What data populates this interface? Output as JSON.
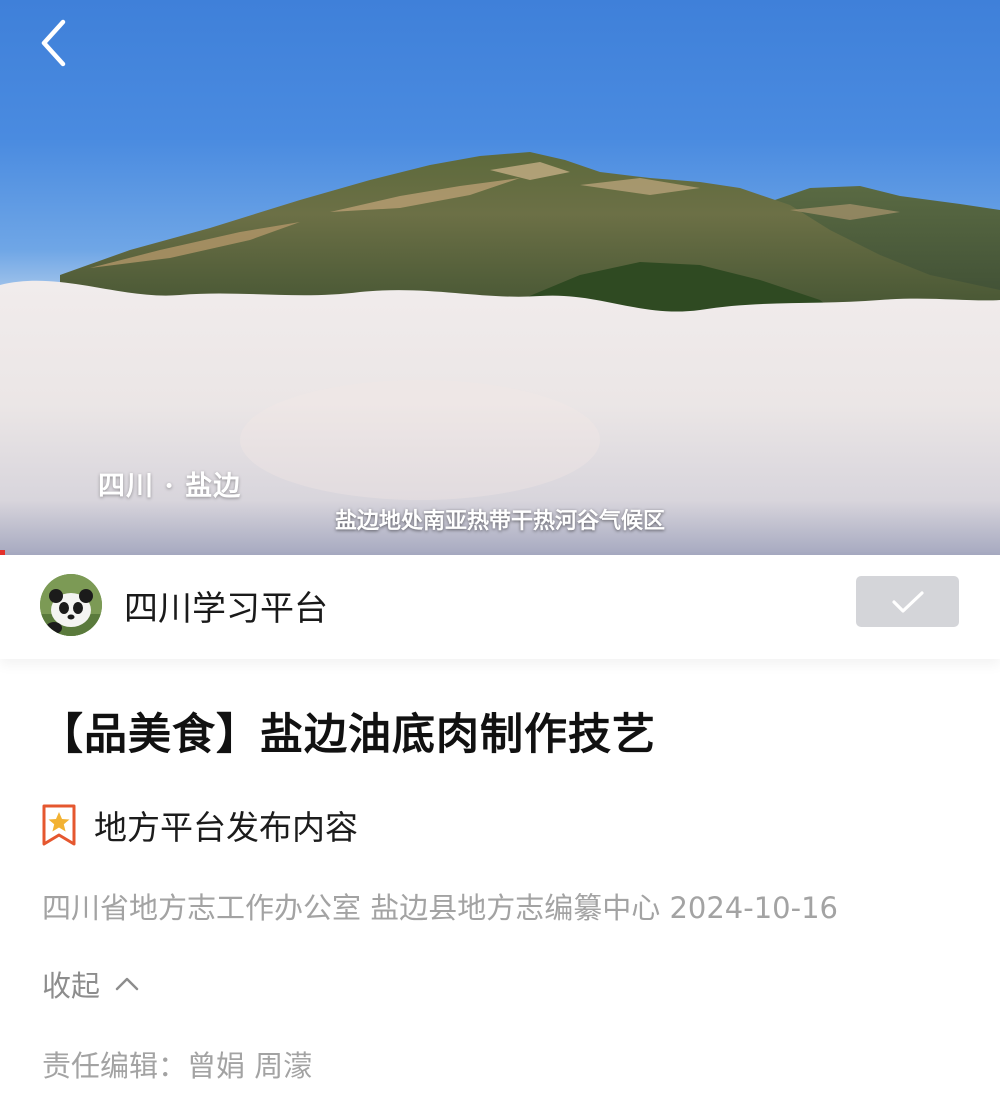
{
  "video": {
    "location_caption": "四川 · 盐边",
    "subtitle": "盐边地处南亚热带干热河谷气候区",
    "progress": 0.005
  },
  "account": {
    "name": "四川学习平台",
    "avatar_icon": "panda-avatar",
    "follow_icon": "checkmark-icon"
  },
  "article": {
    "title": "【品美食】盐边油底肉制作技艺",
    "badge_icon": "star-ribbon-icon",
    "badge_text": "地方平台发布内容",
    "source": "四川省地方志工作办公室 盐边县地方志编纂中心  2024-10-16",
    "collapse_label": "收起",
    "editor_line": "责任编辑：曾娟 周濛"
  },
  "colors": {
    "progress": "#e4312b",
    "badge": "#e5572f",
    "follow_bg": "#d4d5d9"
  }
}
